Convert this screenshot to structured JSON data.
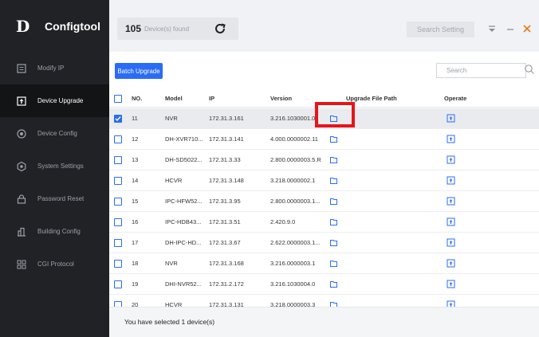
{
  "app": {
    "title": "Configtool",
    "logo_glyph": "D"
  },
  "sidebar": {
    "items": [
      {
        "label": "Modify IP",
        "icon": "modify-ip-icon",
        "active": false
      },
      {
        "label": "Device Upgrade",
        "icon": "upgrade-icon",
        "active": true
      },
      {
        "label": "Device Config",
        "icon": "device-config-icon",
        "active": false
      },
      {
        "label": "System Settings",
        "icon": "system-settings-icon",
        "active": false
      },
      {
        "label": "Password Reset",
        "icon": "password-reset-icon",
        "active": false
      },
      {
        "label": "Building Config",
        "icon": "building-config-icon",
        "active": false
      },
      {
        "label": "CGI Protocol",
        "icon": "cgi-protocol-icon",
        "active": false
      }
    ]
  },
  "topbar": {
    "device_count": "105",
    "device_count_label": "Device(s) found",
    "search_setting": "Search Setting"
  },
  "toolbar": {
    "batch_upgrade": "Batch Upgrade",
    "search_placeholder": "Search"
  },
  "table": {
    "headers": {
      "no": "NO.",
      "model": "Model",
      "ip": "IP",
      "version": "Version",
      "path": "Upgrade File Path",
      "operate": "Operate"
    },
    "rows": [
      {
        "no": "11",
        "model": "NVR",
        "ip": "172.31.3.161",
        "version": "3.216.1030001.0",
        "checked": true
      },
      {
        "no": "12",
        "model": "DH-XVR710...",
        "ip": "172.31.3.141",
        "version": "4.000.0000002.11",
        "checked": false
      },
      {
        "no": "13",
        "model": "DH-SD5022...",
        "ip": "172.31.3.33",
        "version": "2.800.0000003.5.R",
        "checked": false
      },
      {
        "no": "14",
        "model": "HCVR",
        "ip": "172.31.3.148",
        "version": "3.218.0000002.1",
        "checked": false
      },
      {
        "no": "15",
        "model": "IPC-HFW52...",
        "ip": "172.31.3.95",
        "version": "2.800.0000003.1...",
        "checked": false
      },
      {
        "no": "16",
        "model": "IPC-HDB43...",
        "ip": "172.31.3.51",
        "version": "2.420.9.0",
        "checked": false
      },
      {
        "no": "17",
        "model": "DH-IPC-HD...",
        "ip": "172.31.3.67",
        "version": "2.622.0000003.1...",
        "checked": false
      },
      {
        "no": "18",
        "model": "NVR",
        "ip": "172.31.3.168",
        "version": "3.216.0000003.1",
        "checked": false
      },
      {
        "no": "19",
        "model": "DHI-NVR52...",
        "ip": "172.31.2.172",
        "version": "3.216.1030004.0",
        "checked": false
      },
      {
        "no": "20",
        "model": "HCVR",
        "ip": "172.31.3.131",
        "version": "3.218.0000003.3",
        "checked": false
      }
    ]
  },
  "footer": {
    "selected_text": "You have selected 1  device(s)"
  },
  "colors": {
    "accent": "#2a6cf6",
    "highlight": "#e8141a",
    "sidebar_bg": "#202225"
  }
}
